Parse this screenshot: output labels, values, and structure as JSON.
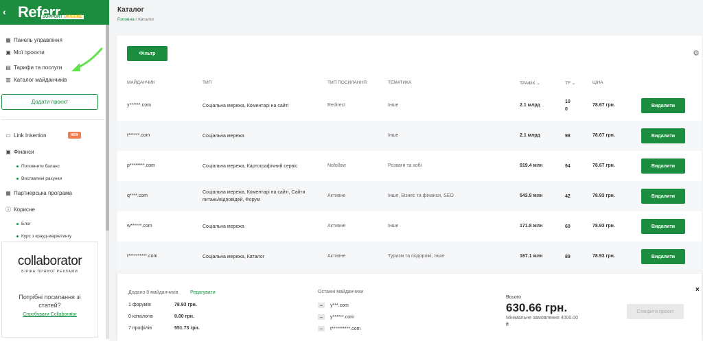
{
  "brand": {
    "logo_text": "Referr",
    "logo_sub_1": "SUPPORT",
    "logo_sub_2": "UKRAINE",
    "back_icon": "chevron-left-icon",
    "color": "#1c8c3f"
  },
  "sidebar": {
    "items": [
      {
        "icon": "dashboard-icon",
        "glyph": "▦",
        "label": "Панель управління"
      },
      {
        "icon": "briefcase-icon",
        "glyph": "▣",
        "label": "Мої проєкти"
      },
      {
        "icon": "tag-icon",
        "glyph": "▤",
        "label": "Тарифи та послуги"
      },
      {
        "icon": "catalog-icon",
        "glyph": "▥",
        "label": "Каталог майданчиків"
      }
    ],
    "add_project": "Додати проєкт",
    "items2": [
      {
        "icon": "link-icon",
        "glyph": "▭",
        "label": "Link Insertion",
        "badge": "NEW"
      },
      {
        "icon": "wallet-icon",
        "glyph": "▣",
        "label": "Фінанси"
      }
    ],
    "finance_sub": [
      "Поповнити баланс",
      "Виставлені рахунки"
    ],
    "items3": [
      {
        "icon": "partner-icon",
        "glyph": "▦",
        "label": "Партнерська програма"
      },
      {
        "icon": "info-icon",
        "glyph": "ⓘ",
        "label": "Корисне"
      }
    ],
    "useful_sub": [
      "Блог",
      "Курс з крауд-маркетингу"
    ],
    "collaborator": {
      "logo": "collaborator",
      "tagline": "БІРЖА ПРЯМОЇ РЕКЛАМИ",
      "question": "Потрібні посилання зі статей?",
      "link": "Спробувати Collaborator"
    }
  },
  "header": {
    "title": "Каталог",
    "breadcrumb_home": "Головна",
    "breadcrumb_sep": "/",
    "breadcrumb_current": "Каталог"
  },
  "toolbar": {
    "filter": "Фільтр",
    "settings_icon": "gear-icon"
  },
  "table": {
    "headers": [
      "МАЙДАНЧИК",
      "ТИП",
      "ТИП ПОСИЛАННЯ",
      "ТЕМАТИКА",
      "ТРАФІК ⌄",
      "TF ⌄",
      "ЦІНА"
    ],
    "delete_label": "Видалити",
    "rows": [
      {
        "site": "y******.com",
        "type": "Соціальна мережа, Коментарі на сайті",
        "link_type": "Redirect",
        "topic": "Інше",
        "traffic": "2.1 млрд",
        "tf": "10\n0",
        "price": "78.67 грн."
      },
      {
        "site": "t******.com",
        "type": "Соціальна мережа",
        "link_type": "",
        "topic": "Інше",
        "traffic": "2.1 млрд",
        "tf": "98",
        "price": "78.67 грн."
      },
      {
        "site": "p********.com",
        "type": "Соціальна мережа, Картографічний сервіс",
        "link_type": "Nofollow",
        "topic": "Розваги та хобі",
        "traffic": "919.4 млн",
        "tf": "94",
        "price": "78.67 грн."
      },
      {
        "site": "q****.com",
        "type": "Соціальна мережа, Коментарі на сайті, Сайти питань/відповідей, Форум",
        "link_type": "Активне",
        "topic": "Інше, Бізнес та фінанси, SEO",
        "traffic": "543.8 млн",
        "tf": "42",
        "price": "78.93 грн."
      },
      {
        "site": "w******.com",
        "type": "Соціальна мережа",
        "link_type": "Активне",
        "topic": "Інше",
        "traffic": "171.8 млн",
        "tf": "60",
        "price": "78.93 грн."
      },
      {
        "site": "t**********.com",
        "type": "Соціальна мережа, Каталог",
        "link_type": "Активне",
        "topic": "Туризм та подорожі, Інше",
        "traffic": "167.1 млн",
        "tf": "89",
        "price": "78.93 грн."
      }
    ]
  },
  "summary": {
    "added": "Додано 8 майданчиків",
    "edit": "Редагувати",
    "lines": [
      {
        "label": "1 форумів",
        "value": "78.93 грн."
      },
      {
        "label": "0 каталогів",
        "value": "0.00 грн."
      },
      {
        "label": "7 профілів",
        "value": "551.73 грн."
      }
    ],
    "recent_title": "Останні майданчики",
    "recent": [
      "y***.com",
      "y******.com",
      "t**********.com"
    ],
    "total_label": "Всього",
    "total": "630.66 грн.",
    "min_order": "Мінімальне замовлення 4000.00",
    "min_order_2": "₴",
    "create": "Створити проєкт",
    "close": "×"
  }
}
